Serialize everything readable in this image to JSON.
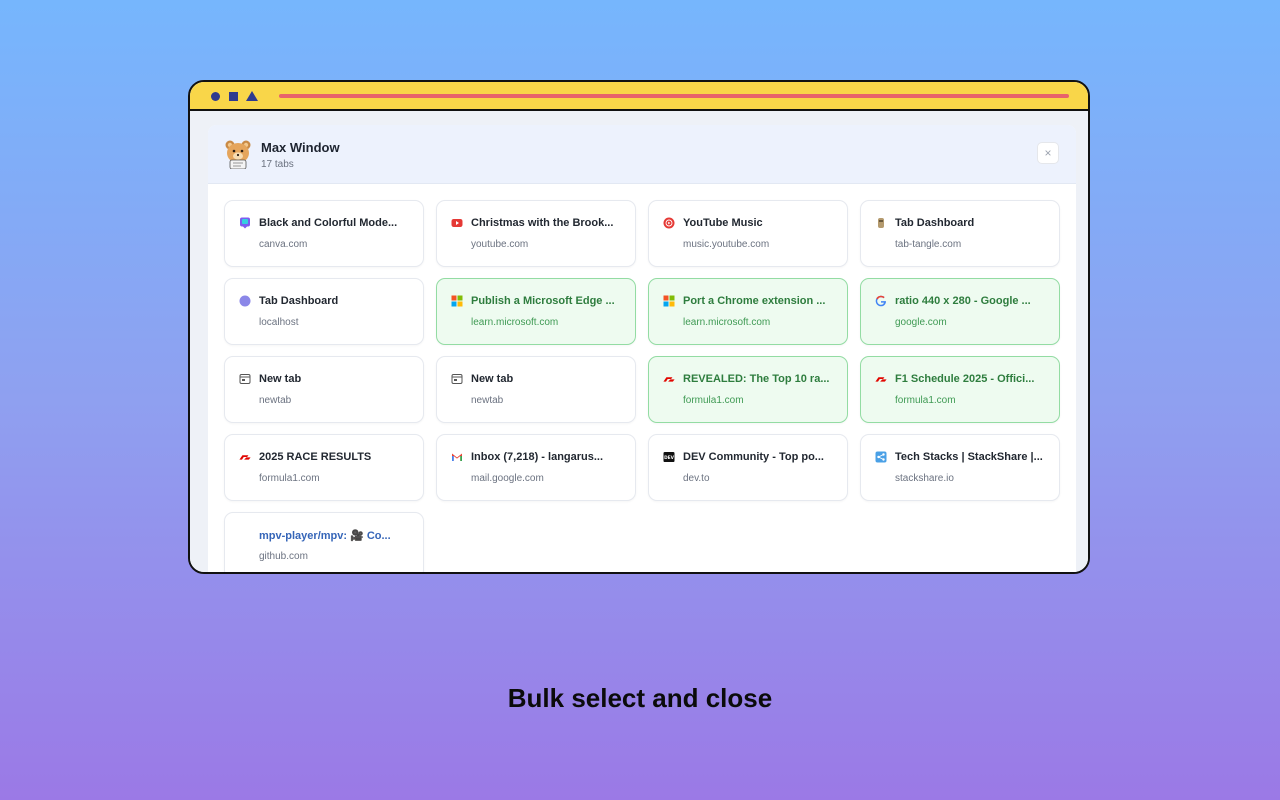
{
  "window": {
    "title": "Max Window",
    "tab_count": "17 tabs",
    "close_label": "×"
  },
  "tabs": [
    {
      "title": "Black and Colorful Mode...",
      "domain": "canva.com",
      "icon": "canva-icon",
      "selected": false
    },
    {
      "title": "Christmas with the Brook...",
      "domain": "youtube.com",
      "icon": "youtube-icon",
      "selected": false
    },
    {
      "title": "YouTube Music",
      "domain": "music.youtube.com",
      "icon": "youtube-music-icon",
      "selected": false
    },
    {
      "title": "Tab Dashboard",
      "domain": "tab-tangle.com",
      "icon": "tab-tangle-icon",
      "selected": false
    },
    {
      "title": "Tab Dashboard",
      "domain": "localhost",
      "icon": "purple-dot-icon",
      "selected": false
    },
    {
      "title": "Publish a Microsoft Edge ...",
      "domain": "learn.microsoft.com",
      "icon": "microsoft-icon",
      "selected": true
    },
    {
      "title": "Port a Chrome extension ...",
      "domain": "learn.microsoft.com",
      "icon": "microsoft-icon",
      "selected": true
    },
    {
      "title": "ratio 440 x 280 - Google ...",
      "domain": "google.com",
      "icon": "google-icon",
      "selected": true
    },
    {
      "title": "New tab",
      "domain": "newtab",
      "icon": "newtab-icon",
      "selected": false
    },
    {
      "title": "New tab",
      "domain": "newtab",
      "icon": "newtab-icon",
      "selected": false
    },
    {
      "title": "REVEALED: The Top 10 ra...",
      "domain": "formula1.com",
      "icon": "f1-icon",
      "selected": true
    },
    {
      "title": "F1 Schedule 2025 - Offici...",
      "domain": "formula1.com",
      "icon": "f1-icon",
      "selected": true
    },
    {
      "title": "2025 RACE RESULTS",
      "domain": "formula1.com",
      "icon": "f1-icon",
      "selected": false
    },
    {
      "title": "Inbox (7,218) - langarus...",
      "domain": "mail.google.com",
      "icon": "gmail-icon",
      "selected": false
    },
    {
      "title": "DEV Community - Top po...",
      "domain": "dev.to",
      "icon": "dev-icon",
      "selected": false
    },
    {
      "title": "Tech Stacks | StackShare |...",
      "domain": "stackshare.io",
      "icon": "stackshare-icon",
      "selected": false
    },
    {
      "title": "mpv-player/mpv: 🎥 Co...",
      "domain": "github.com",
      "icon": "github-icon",
      "selected": false
    }
  ],
  "caption": "Bulk select and close",
  "colors": {
    "selected_bg": "#eefbf0",
    "selected_border": "#93dca3",
    "titlebar": "#f9d649",
    "accent_line": "#e8636b"
  }
}
